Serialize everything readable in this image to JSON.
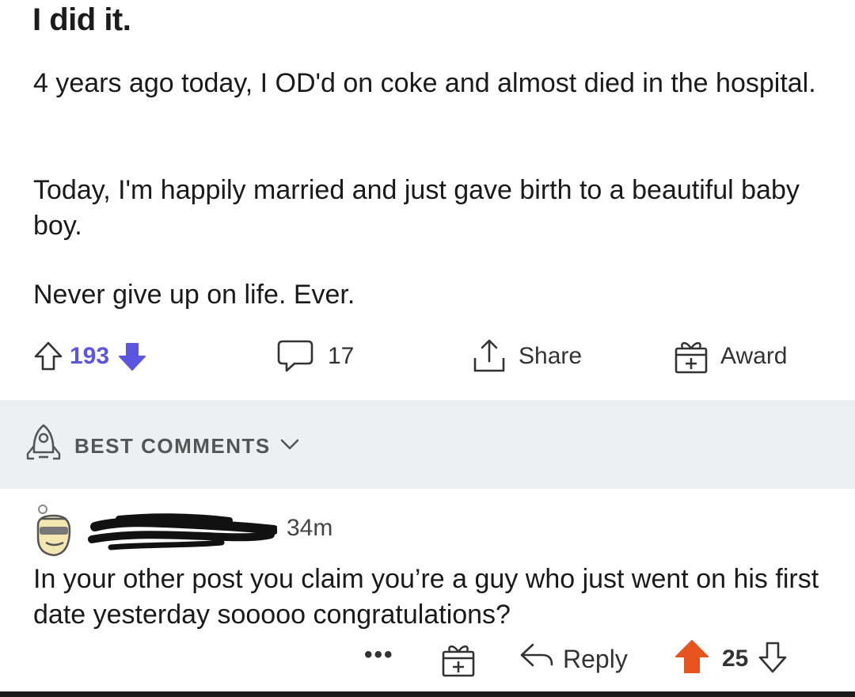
{
  "post": {
    "title": "I did it.",
    "paragraphs": [
      "4 years ago today, I OD'd on coke and almost died in the hospital.",
      "Today, I'm happily married and just gave birth to a beautiful baby boy.",
      "Never give up on life. Ever."
    ],
    "vote_count": "193",
    "comment_count": "17",
    "share_label": "Share",
    "award_label": "Award"
  },
  "sort": {
    "label": "BEST COMMENTS"
  },
  "comment": {
    "time": "34m",
    "body": "In your other post you claim you’re a guy who just went on his first date yesterday sooooo congratulations?",
    "more": "•••",
    "reply_label": "Reply",
    "vote_count": "25"
  },
  "colors": {
    "downvote_active": "#5b55e0",
    "upvote_active": "#e8541e",
    "sort_bar_bg": "#edeff1"
  },
  "icons": [
    "upvote-icon",
    "downvote-icon",
    "comment-icon",
    "share-icon",
    "award-icon",
    "rocket-icon",
    "chevron-down-icon",
    "avatar",
    "reply-icon"
  ]
}
